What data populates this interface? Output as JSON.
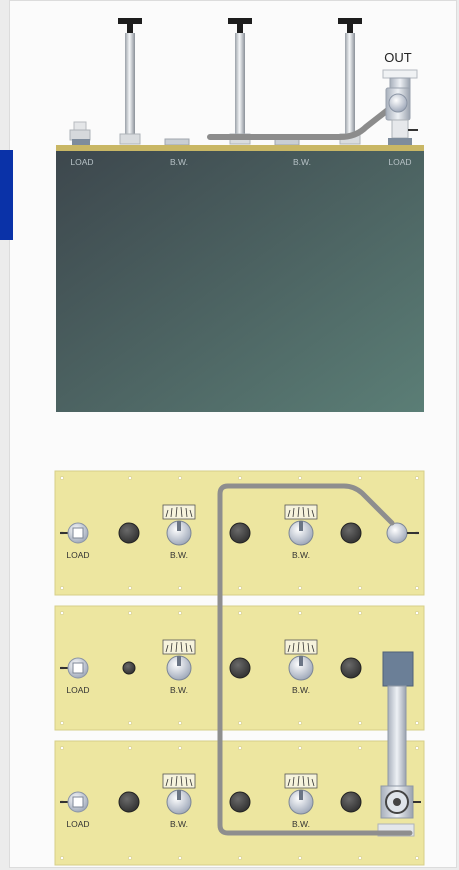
{
  "side_view": {
    "out_label": "OUT",
    "bar_labels": [
      "LOAD",
      "B.W.",
      "B.W.",
      "LOAD"
    ]
  },
  "front_view": {
    "panels": [
      {
        "labels": [
          "LOAD",
          "B.W.",
          "B.W."
        ]
      },
      {
        "labels": [
          "LOAD",
          "B.W.",
          "B.W."
        ]
      },
      {
        "labels": [
          "LOAD",
          "B.W.",
          "B.W."
        ]
      }
    ]
  },
  "colors": {
    "accent_tab": "#0a32a8",
    "cavity_body_left": "#3f4b51",
    "cavity_body_right": "#5a7b74",
    "top_plate": "#c9b765",
    "panel_plate": "#ede6a0",
    "cable": "#8e8e8e"
  }
}
